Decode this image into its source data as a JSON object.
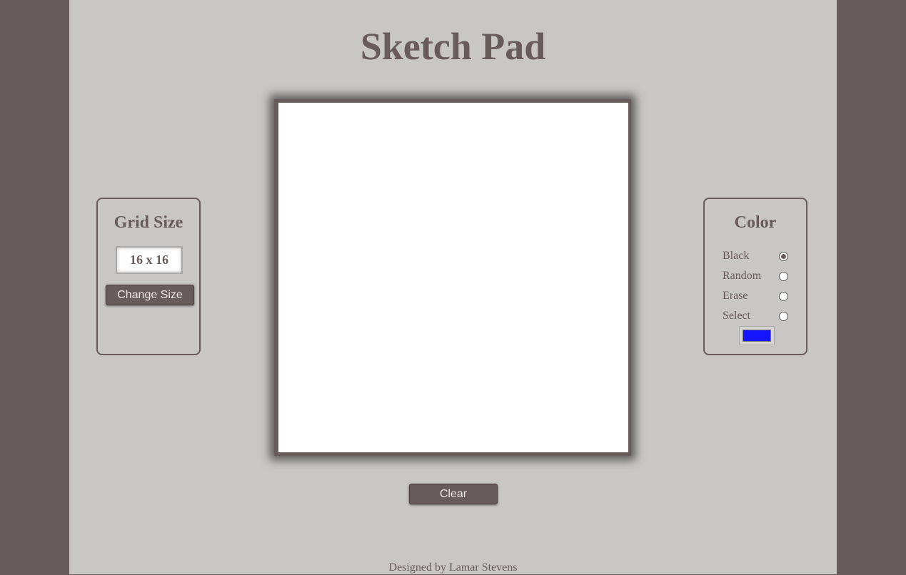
{
  "header": {
    "title": "Sketch Pad"
  },
  "grid_panel": {
    "title": "Grid Size",
    "size_value": "16 x 16",
    "change_button": "Change Size"
  },
  "color_panel": {
    "title": "Color",
    "options": [
      {
        "label": "Black",
        "checked": true
      },
      {
        "label": "Random",
        "checked": false
      },
      {
        "label": "Erase",
        "checked": false
      },
      {
        "label": "Select",
        "checked": false
      }
    ],
    "selected_color": "#1414ff"
  },
  "actions": {
    "clear_button": "Clear"
  },
  "footer": {
    "credit": "Designed by Lamar Stevens"
  },
  "theme": {
    "accent": "#685b5b",
    "background": "#c8c7c5",
    "canvas": "#ffffff"
  }
}
